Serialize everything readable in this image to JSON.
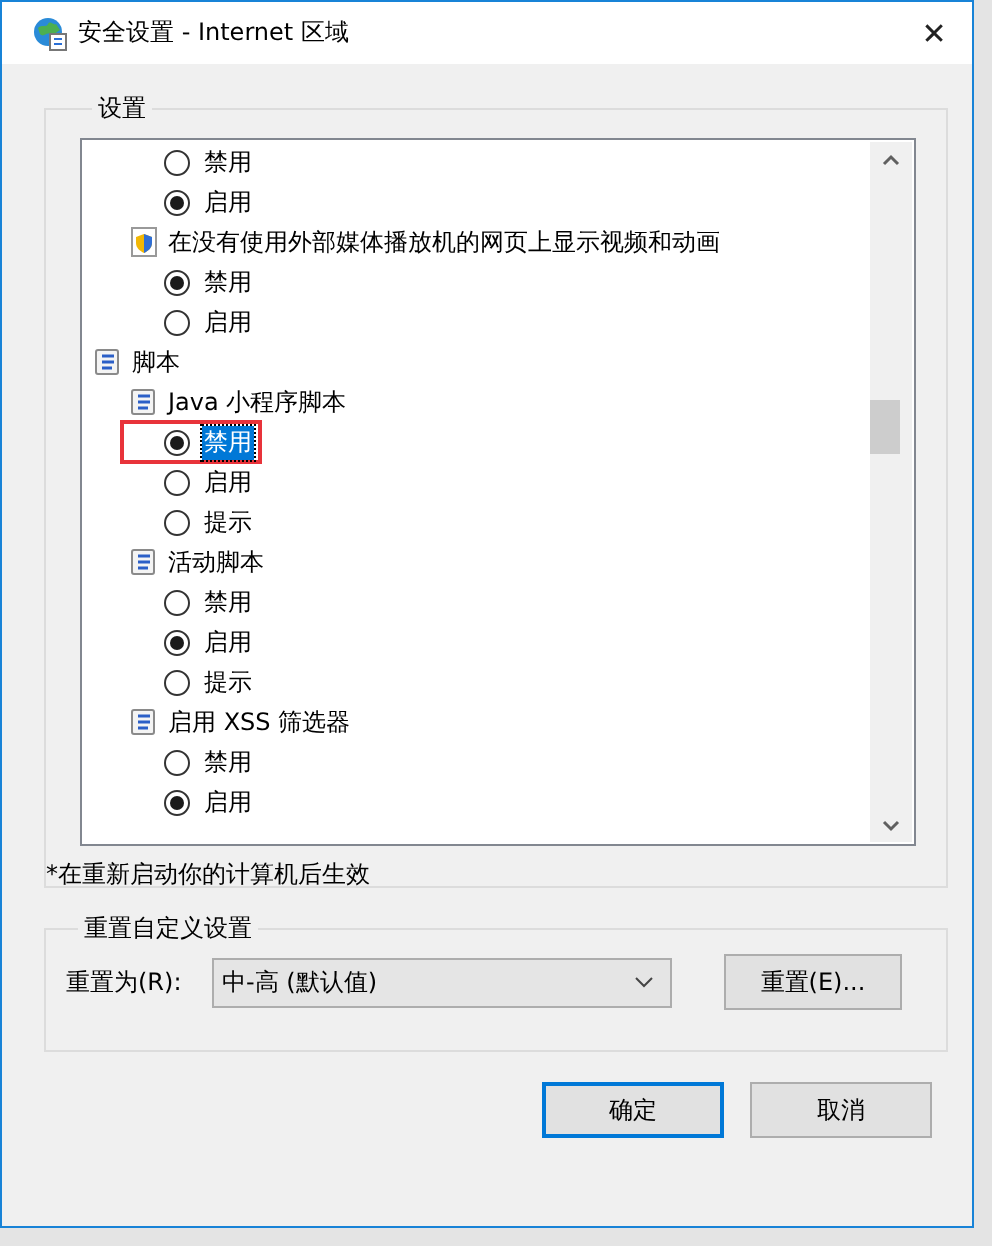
{
  "window": {
    "title": "安全设置 - Internet 区域",
    "close": "✕"
  },
  "settings": {
    "title": "设置",
    "tree": [
      {
        "kind": "continued",
        "children": [
          {
            "kind": "continued",
            "children": [
              {
                "kind": "radio",
                "label": "禁用",
                "checked": false,
                "focused": false,
                "annotated": false
              },
              {
                "kind": "radio",
                "label": "启用",
                "checked": true,
                "focused": false,
                "annotated": false
              }
            ]
          },
          {
            "kind": "shield",
            "label": "在没有使用外部媒体播放机的网页上显示视频和动画",
            "children": [
              {
                "kind": "radio",
                "label": "禁用",
                "checked": true,
                "focused": false,
                "annotated": false
              },
              {
                "kind": "radio",
                "label": "启用",
                "checked": false,
                "focused": false,
                "annotated": false
              }
            ]
          }
        ]
      },
      {
        "kind": "script",
        "label": "脚本",
        "children": [
          {
            "kind": "script",
            "label": "Java 小程序脚本",
            "children": [
              {
                "kind": "radio",
                "label": "禁用",
                "checked": true,
                "focused": true,
                "annotated": true
              },
              {
                "kind": "radio",
                "label": "启用",
                "checked": false,
                "focused": false,
                "annotated": false
              },
              {
                "kind": "radio",
                "label": "提示",
                "checked": false,
                "focused": false,
                "annotated": false
              }
            ]
          },
          {
            "kind": "script",
            "label": "活动脚本",
            "children": [
              {
                "kind": "radio",
                "label": "禁用",
                "checked": false,
                "focused": false,
                "annotated": false
              },
              {
                "kind": "radio",
                "label": "启用",
                "checked": true,
                "focused": false,
                "annotated": false
              },
              {
                "kind": "radio",
                "label": "提示",
                "checked": false,
                "focused": false,
                "annotated": false
              }
            ]
          },
          {
            "kind": "script",
            "label": "启用 XSS 筛选器",
            "children": [
              {
                "kind": "radio",
                "label": "禁用",
                "checked": false,
                "focused": false,
                "annotated": false
              },
              {
                "kind": "radio",
                "label": "启用",
                "checked": true,
                "focused": false,
                "annotated": false
              }
            ]
          }
        ]
      }
    ],
    "note": "*在重新启动你的计算机后生效"
  },
  "reset": {
    "title": "重置自定义设置",
    "label": "重置为(R):",
    "value": "中-高 (默认值)",
    "button": "重置(E)..."
  },
  "buttons": [
    {
      "label": "确定",
      "default": true
    },
    {
      "label": "取消",
      "default": false
    }
  ]
}
